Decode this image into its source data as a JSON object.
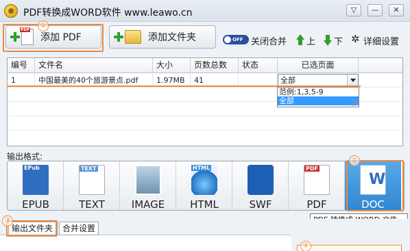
{
  "window": {
    "title": "PDF转换成WORD软件 www.leawo.cn",
    "min_glyph": "▽",
    "restore_glyph": "—",
    "close_glyph": "✕"
  },
  "toolbar": {
    "add_pdf_label": "添加 PDF",
    "add_folder_label": "添加文件夹",
    "merge_toggle_state": "OFF",
    "merge_label": "关闭合并",
    "up_label": "上",
    "down_label": "下",
    "settings_label": "详细设置",
    "gear_glyph": "✲"
  },
  "callouts": [
    "①",
    "②",
    "③",
    "④"
  ],
  "table": {
    "columns": [
      "编号",
      "文件名",
      "大小",
      "页数总数",
      "状态",
      "已选页面"
    ],
    "rows": [
      {
        "num": "1",
        "filename": "中国最美的40个旅游景点.pdf",
        "size": "1.97MB",
        "pages": "41",
        "status": "",
        "selected": "全部"
      }
    ],
    "dropdown_options": [
      "范例:1,3,5-9",
      "全部"
    ],
    "dropdown_selected_index": 1
  },
  "output": {
    "label": "输出格式:",
    "formats": [
      {
        "label": "EPUB",
        "badge": "EPub",
        "color": "#2f6fbf"
      },
      {
        "label": "TEXT",
        "badge": "TEXT",
        "color": "#5a93d6"
      },
      {
        "label": "IMAGE",
        "badge": "",
        "color": "#7a9cb8"
      },
      {
        "label": "HTML",
        "badge": "HTML",
        "color": "#3a8fd8"
      },
      {
        "label": "SWF",
        "badge": "",
        "color": "#1d5fb3"
      },
      {
        "label": "PDF",
        "badge": "PDF",
        "color": "#c9302c"
      },
      {
        "label": "DOC",
        "badge": "W",
        "color": "#ffffff"
      }
    ],
    "active_index": 6,
    "tooltip": "PDF 转换成 WORD 文件"
  },
  "bottom": {
    "tab_output_folder": "输出文件夹",
    "tab_merge_settings": "合并设置"
  }
}
